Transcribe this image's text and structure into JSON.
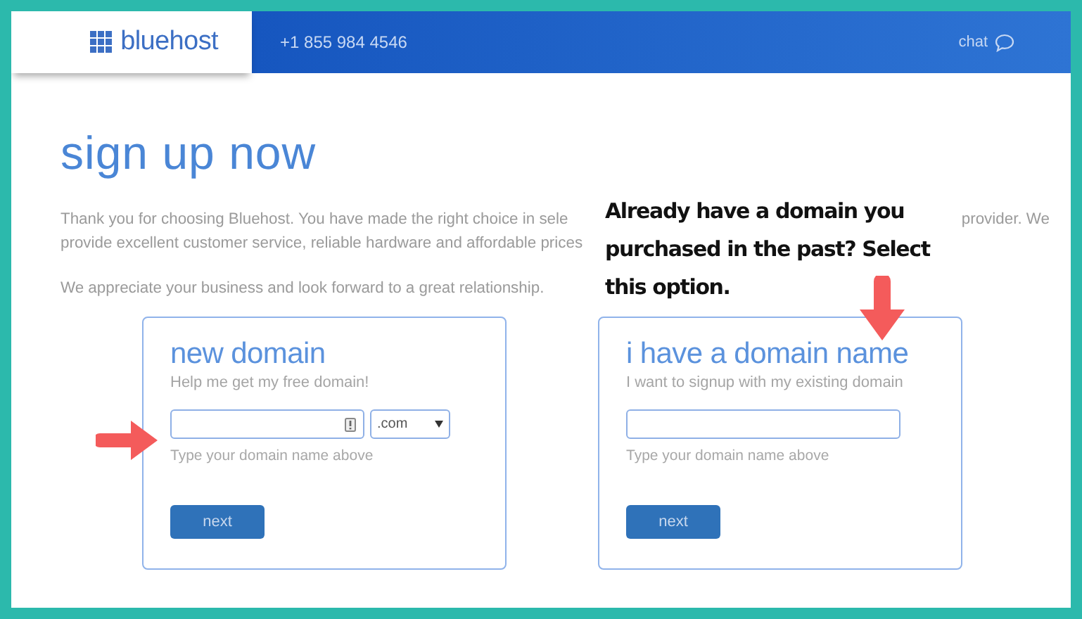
{
  "header": {
    "logo": "bluehost",
    "phone": "+1 855 984 4546",
    "chat": "chat"
  },
  "title": "sign up now",
  "intro": {
    "line_1_start": "Thank you for choosing Bluehost. You have made the right choice in sele",
    "line_1_end": "provider. We",
    "line_2": "provide excellent customer service, reliable hardware and affordable prices"
  },
  "note": "We appreciate your business and look forward to a great relationship.",
  "cards": [
    {
      "title": "new domain",
      "subtitle": "Help me get my free domain!",
      "tld": ".com",
      "hint": "Type your domain name above",
      "button": "next"
    },
    {
      "title": "i have a domain name",
      "subtitle": "I want to signup with my existing domain",
      "hint": "Type your domain name above",
      "button": "next"
    }
  ],
  "annotation": "Already have a domain you purchased in the past? Select this option."
}
